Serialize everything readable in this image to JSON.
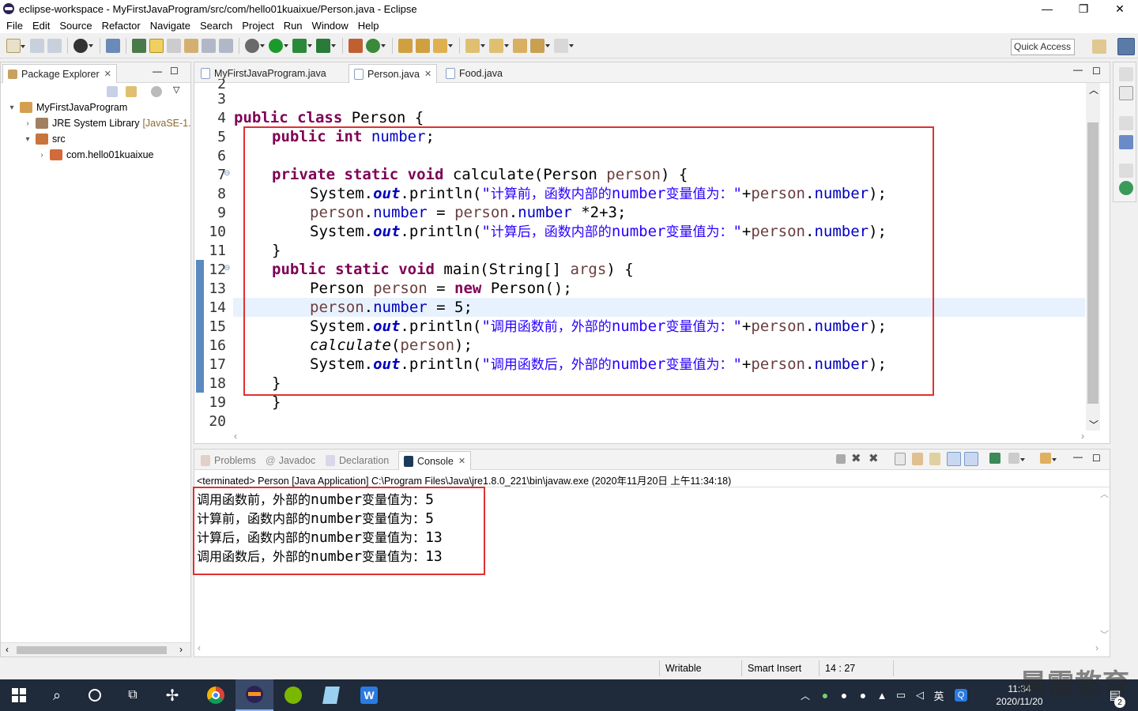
{
  "window": {
    "title": "eclipse-workspace - MyFirstJavaProgram/src/com/hello01kuaixue/Person.java - Eclipse",
    "minimize": "—",
    "maximize": "❐",
    "close": "✕"
  },
  "menu": [
    "File",
    "Edit",
    "Source",
    "Refactor",
    "Navigate",
    "Search",
    "Project",
    "Run",
    "Window",
    "Help"
  ],
  "toolbar": {
    "quick_access": "Quick Access"
  },
  "package_explorer": {
    "tab_label": "Package Explorer",
    "tree": [
      {
        "label": "MyFirstJavaProgram"
      },
      {
        "label": "JRE System Library",
        "suffix": "[JavaSE-1."
      },
      {
        "label": "src"
      },
      {
        "label": "com.hello01kuaixue"
      }
    ]
  },
  "editor": {
    "tabs": [
      {
        "label": "MyFirstJavaProgram.java"
      },
      {
        "label": "Person.java"
      },
      {
        "label": "Food.java"
      }
    ],
    "top_line_number": "2",
    "line_numbers": [
      "3",
      "4",
      "5",
      "6",
      "7",
      "8",
      "9",
      "10",
      "11",
      "12",
      "13",
      "14",
      "15",
      "16",
      "17",
      "18",
      "19",
      "20"
    ],
    "code": {
      "l4": {
        "kw1": "public",
        "kw2": "class",
        "rest": " Person {"
      },
      "l5": {
        "kw1": "public",
        "kw2": "int",
        "field": "number",
        "end": ";"
      },
      "l7": {
        "kw1": "private",
        "kw2": "static",
        "kw3": "void",
        "rest": " calculate(Person ",
        "param": "person",
        "end": ") {"
      },
      "l8": {
        "a": "System.",
        "out": "out",
        "b": ".println(",
        "str_q": "\"",
        "str1": "计算前，函数内部的",
        "str_m": "number",
        "str2": "变量值为：",
        "str_e": "\"",
        "c": "+",
        "var": "person",
        "d": ".",
        "fld": "number",
        "end": ");"
      },
      "l9": {
        "var1": "person",
        "d1": ".",
        "fld1": "number",
        "eq": " = ",
        "var2": "person",
        "d2": ".",
        "fld2": "number",
        "end": " *2+3;"
      },
      "l10": {
        "a": "System.",
        "out": "out",
        "b": ".println(",
        "str_q": "\"",
        "str1": "计算后，函数内部的",
        "str_m": "number",
        "str2": "变量值为：",
        "str_e": "\"",
        "c": "+",
        "var": "person",
        "d": ".",
        "fld": "number",
        "end": ");"
      },
      "l11": {
        "text": "}"
      },
      "l12": {
        "kw1": "public",
        "kw2": "static",
        "kw3": "void",
        "rest": " main(String[] ",
        "param": "args",
        "end": ") {"
      },
      "l13": {
        "a": "Person ",
        "var": "person",
        "eq": " = ",
        "kw": "new",
        "end": " Person();"
      },
      "l14": {
        "var": "person",
        "d": ".",
        "fld": "number",
        "end": " = 5;"
      },
      "l15": {
        "a": "System.",
        "out": "out",
        "b": ".println(",
        "str_q": "\"",
        "str1": "调用函数前，外部的",
        "str_m": "number",
        "str2": "变量值为：",
        "str_e": "\"",
        "c": "+",
        "var": "person",
        "d": ".",
        "fld": "number",
        "end": ");"
      },
      "l16": {
        "call": "calculate",
        "open": "(",
        "var": "person",
        "end": ");"
      },
      "l17": {
        "a": "System.",
        "out": "out",
        "b": ".println(",
        "str_q": "\"",
        "str1": "调用函数后，外部的",
        "str_m": "number",
        "str2": "变量值为：",
        "str_e": "\"",
        "c": "+",
        "var": "person",
        "d": ".",
        "fld": "number",
        "end": ");"
      },
      "l18": {
        "text": "}"
      },
      "l19": {
        "text": "}"
      }
    }
  },
  "bottom_panel": {
    "tabs": [
      {
        "label": "Problems"
      },
      {
        "label": "Javadoc"
      },
      {
        "label": "Declaration"
      },
      {
        "label": "Console"
      }
    ],
    "terminated": "<terminated> Person [Java Application] C:\\Program Files\\Java\\jre1.8.0_221\\bin\\javaw.exe (2020年11月20日 上午11:34:18)",
    "output": [
      {
        "pre": "调用函数前，外部的",
        "mono": "number",
        "post": "变量值为：",
        "val": "5"
      },
      {
        "pre": "计算前，函数内部的",
        "mono": "number",
        "post": "变量值为：",
        "val": "5"
      },
      {
        "pre": "计算后，函数内部的",
        "mono": "number",
        "post": "变量值为：",
        "val": "13"
      },
      {
        "pre": "调用函数后，外部的",
        "mono": "number",
        "post": "变量值为：",
        "val": "13"
      }
    ]
  },
  "status_bar": {
    "writable": "Writable",
    "insert_mode": "Smart Insert",
    "position": "14 : 27"
  },
  "taskbar": {
    "time": "11:34",
    "date": "2020/11/20",
    "ime": "英",
    "notification_count": "2",
    "watermark": "晨需教育"
  },
  "colors": {
    "keyword": "#7f0055",
    "field": "#0000c0",
    "string": "#2a00ff",
    "local_var": "#6a3e3e",
    "highlight_box": "#e03030",
    "current_line": "#e8f2fe"
  }
}
